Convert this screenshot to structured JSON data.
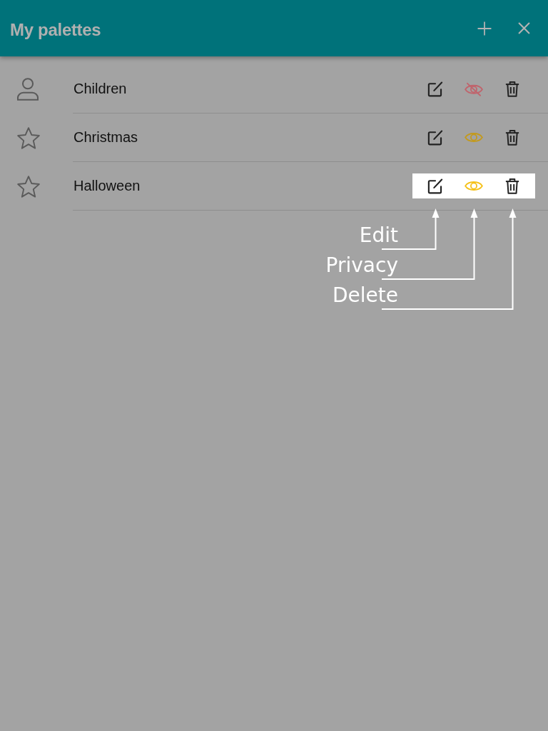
{
  "header": {
    "title": "My palettes"
  },
  "palettes": [
    {
      "name": "Children",
      "kind": "person",
      "private": true,
      "highlighted": false
    },
    {
      "name": "Christmas",
      "kind": "star",
      "private": false,
      "highlighted": false
    },
    {
      "name": "Halloween",
      "kind": "star",
      "private": false,
      "highlighted": true
    }
  ],
  "callouts": [
    {
      "label": "Edit",
      "kind": "edit"
    },
    {
      "label": "Privacy",
      "kind": "privacy"
    },
    {
      "label": "Delete",
      "kind": "delete"
    }
  ]
}
